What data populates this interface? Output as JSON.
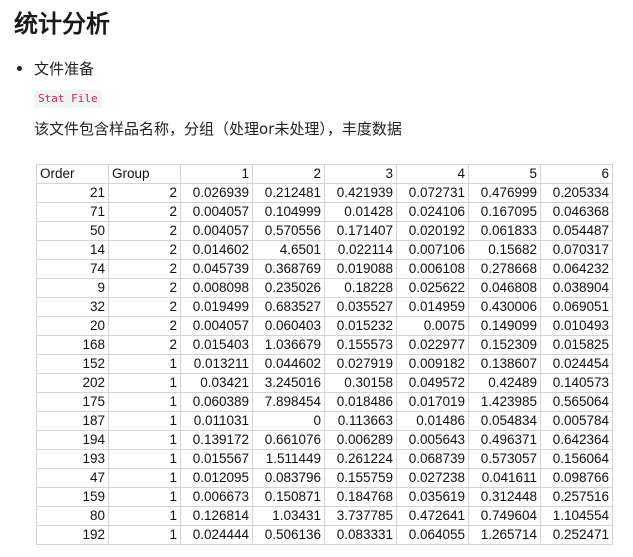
{
  "page": {
    "title": "统计分析",
    "bullet": "文件准备",
    "code_label": "Stat File",
    "description": "该文件包含样品名称，分组（处理or未处理），丰度数据"
  },
  "table": {
    "headers": [
      "Order",
      "Group",
      "1",
      "2",
      "3",
      "4",
      "5",
      "6"
    ],
    "rows": [
      [
        "21",
        "2",
        "0.026939",
        "0.212481",
        "0.421939",
        "0.072731",
        "0.476999",
        "0.205334"
      ],
      [
        "71",
        "2",
        "0.004057",
        "0.104999",
        "0.01428",
        "0.024106",
        "0.167095",
        "0.046368"
      ],
      [
        "50",
        "2",
        "0.004057",
        "0.570556",
        "0.171407",
        "0.020192",
        "0.061833",
        "0.054487"
      ],
      [
        "14",
        "2",
        "0.014602",
        "4.6501",
        "0.022114",
        "0.007106",
        "0.15682",
        "0.070317"
      ],
      [
        "74",
        "2",
        "0.045739",
        "0.368769",
        "0.019088",
        "0.006108",
        "0.278668",
        "0.064232"
      ],
      [
        "9",
        "2",
        "0.008098",
        "0.235026",
        "0.18228",
        "0.025622",
        "0.046808",
        "0.038904"
      ],
      [
        "32",
        "2",
        "0.019499",
        "0.683527",
        "0.035527",
        "0.014959",
        "0.430006",
        "0.069051"
      ],
      [
        "20",
        "2",
        "0.004057",
        "0.060403",
        "0.015232",
        "0.0075",
        "0.149099",
        "0.010493"
      ],
      [
        "168",
        "2",
        "0.015403",
        "1.036679",
        "0.155573",
        "0.022977",
        "0.152309",
        "0.015825"
      ],
      [
        "152",
        "1",
        "0.013211",
        "0.044602",
        "0.027919",
        "0.009182",
        "0.138607",
        "0.024454"
      ],
      [
        "202",
        "1",
        "0.03421",
        "3.245016",
        "0.30158",
        "0.049572",
        "0.42489",
        "0.140573"
      ],
      [
        "175",
        "1",
        "0.060389",
        "7.898454",
        "0.018486",
        "0.017019",
        "1.423985",
        "0.565064"
      ],
      [
        "187",
        "1",
        "0.011031",
        "0",
        "0.113663",
        "0.01486",
        "0.054834",
        "0.005784"
      ],
      [
        "194",
        "1",
        "0.139172",
        "0.661076",
        "0.006289",
        "0.005643",
        "0.496371",
        "0.642364"
      ],
      [
        "193",
        "1",
        "0.015567",
        "1.511449",
        "0.261224",
        "0.068739",
        "0.573057",
        "0.156064"
      ],
      [
        "47",
        "1",
        "0.012095",
        "0.083796",
        "0.155759",
        "0.027238",
        "0.041611",
        "0.098766"
      ],
      [
        "159",
        "1",
        "0.006673",
        "0.150871",
        "0.184768",
        "0.035619",
        "0.312448",
        "0.257516"
      ],
      [
        "80",
        "1",
        "0.126814",
        "1.03431",
        "3.737785",
        "0.472641",
        "0.749604",
        "1.104554"
      ],
      [
        "192",
        "1",
        "0.024444",
        "0.506136",
        "0.083331",
        "0.064055",
        "1.265714",
        "0.252471"
      ]
    ]
  }
}
